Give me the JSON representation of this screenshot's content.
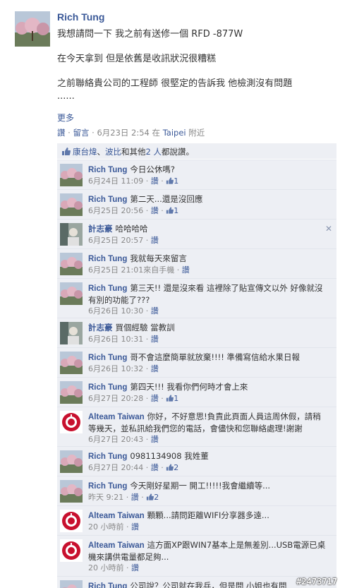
{
  "post": {
    "author": "Rich Tung",
    "lines": [
      "我想請問一下 我之前有送修一個 RFD -877W",
      "在今天拿到 但是依舊是收訊狀況很糟糕",
      "之前聯絡貴公司的工程師 很堅定的告訴我 他檢測沒有問題",
      "......"
    ],
    "more": "更多",
    "meta": {
      "like": "讚",
      "sep": " · ",
      "comment": "留言",
      "time": "6月23日 2:54",
      "place_prefix": "在",
      "place": "Taipei",
      "place_suffix": "附近"
    }
  },
  "likes_bar": {
    "name1": "康台煒",
    "sep": "、",
    "name2": "波比",
    "mid": "和其他",
    "others": "2 人",
    "suffix": "都說讚。"
  },
  "comments": [
    {
      "author": "Rich Tung",
      "text": "今日公休嗎?",
      "time": "6月24日 11:09",
      "like": "讚",
      "likes": "1",
      "avatar": "blossom"
    },
    {
      "author": "Rich Tung",
      "text": "第二天...還是沒回應",
      "time": "6月25日 20:56",
      "like": "讚",
      "likes": "1",
      "avatar": "blossom"
    },
    {
      "author": "計志豪",
      "text": "哈哈哈哈",
      "time": "6月25日 20:57",
      "like": "讚",
      "likes": "",
      "avatar": "person",
      "closable": true
    },
    {
      "author": "Rich Tung",
      "text": "我就每天來留言",
      "time": "6月25日 21:01",
      "device": "來自手機",
      "like": "讚",
      "likes": "",
      "avatar": "blossom"
    },
    {
      "author": "Rich Tung",
      "text": "第三天!! 還是沒來看 這裡除了貼宣傳文以外 好像就沒有別的功能了???",
      "time": "6月26日 10:30",
      "like": "讚",
      "likes": "",
      "avatar": "blossom"
    },
    {
      "author": "計志豪",
      "text": "買個經驗 當教訓",
      "time": "6月26日 10:31",
      "like": "讚",
      "likes": "",
      "avatar": "person"
    },
    {
      "author": "Rich Tung",
      "text": "哥不會這麼簡單就放棄!!!! 準備寫信給水果日報",
      "time": "6月26日 10:32",
      "like": "讚",
      "likes": "",
      "avatar": "blossom"
    },
    {
      "author": "Rich Tung",
      "text": "第四天!!! 我看你們何時才會上來",
      "time": "6月27日 20:28",
      "like": "讚",
      "likes": "1",
      "avatar": "blossom"
    },
    {
      "author": "Alteam Taiwan",
      "text": "你好，不好意思!負責此頁面人員這周休假，請稍等幾天，並私訊給我們您的電話，會儘快和您聯絡處理!謝謝",
      "time": "6月27日 20:43",
      "like": "讚",
      "likes": "",
      "avatar": "alteam"
    },
    {
      "author": "Rich Tung",
      "text": "0981134908 我姓董",
      "time": "6月27日 20:44",
      "like": "讚",
      "likes": "2",
      "avatar": "blossom"
    },
    {
      "author": "Rich Tung",
      "text": "今天剛好星期一 開工!!!!!我會繼續等...",
      "time": "昨天 9:21",
      "like": "讚",
      "likes": "2",
      "avatar": "blossom"
    },
    {
      "author": "Alteam Taiwan",
      "text": "顆顆...請問距離WIFI分享器多遠...",
      "time": "20 小時前",
      "like": "讚",
      "likes": "",
      "avatar": "alteam"
    },
    {
      "author": "Alteam Taiwan",
      "text": "這方面XP跟WIN7基本上是無差別...USB電源已桌機來講供電量都足夠...",
      "time": "20 小時前",
      "like": "讚",
      "likes": "",
      "avatar": "alteam"
    },
    {
      "author": "Rich Tung",
      "text": "公司說？公司就在我兵，但是問  小姐也有問",
      "time": "",
      "like": "",
      "likes": "",
      "avatar": "blossom"
    }
  ],
  "watermark": "#2473717",
  "colors": {
    "link": "#3b5998",
    "bar": "#edeff4",
    "meta": "#888888",
    "alteam_red": "#c8102e"
  }
}
